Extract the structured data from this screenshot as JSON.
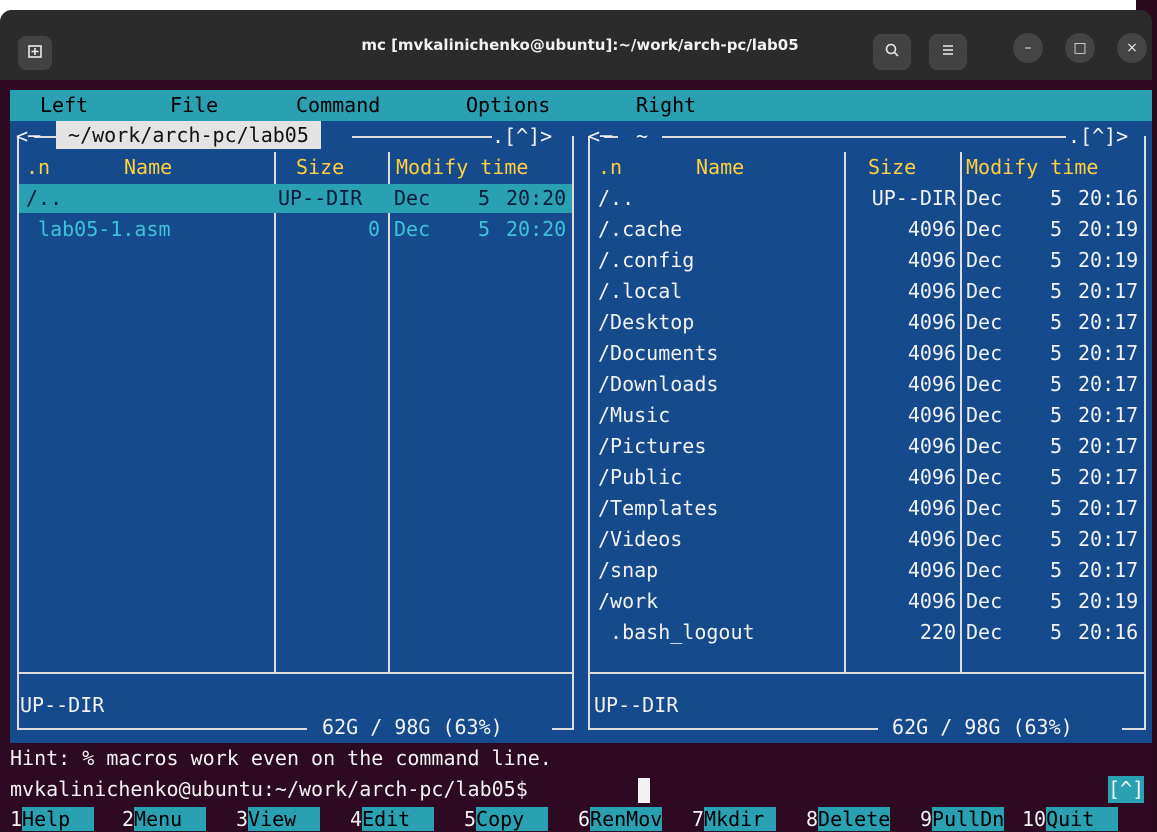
{
  "window": {
    "title": "mc [mvkalinichenko@ubuntu]:~/work/arch-pc/lab05",
    "new_tab_icon": "new-tab-icon",
    "buttons": {
      "search": "⌕",
      "menu": "≡",
      "minimize": "–",
      "maximize": "□",
      "close": "×"
    }
  },
  "menubar": {
    "items": [
      "Left",
      "File",
      "Command",
      "Options",
      "Right"
    ]
  },
  "left_panel": {
    "top_left": "<─",
    "path": " ~/work/arch-pc/lab05 ",
    "top_right": ".[^]>",
    "columns": [
      ".n",
      "Name",
      "Size",
      "Modify time"
    ],
    "rows": [
      {
        "name": "/..",
        "size": "UP--DIR",
        "month": "Dec",
        "day": "5",
        "time": "20:20"
      },
      {
        "name": " lab05-1.asm",
        "size": "0",
        "month": "Dec",
        "day": "5",
        "time": "20:20"
      }
    ],
    "status": "UP--DIR",
    "disk": " 62G / 98G (63%) "
  },
  "right_panel": {
    "top_left": "<─",
    "path": " ~ ",
    "top_right": ".[^]>",
    "columns": [
      ".n",
      "Name",
      "Size",
      "Modify time"
    ],
    "rows": [
      {
        "name": "/..",
        "size": "UP--DIR",
        "month": "Dec",
        "day": "5",
        "time": "20:16"
      },
      {
        "name": "/.cache",
        "size": "4096",
        "month": "Dec",
        "day": "5",
        "time": "20:19"
      },
      {
        "name": "/.config",
        "size": "4096",
        "month": "Dec",
        "day": "5",
        "time": "20:19"
      },
      {
        "name": "/.local",
        "size": "4096",
        "month": "Dec",
        "day": "5",
        "time": "20:17"
      },
      {
        "name": "/Desktop",
        "size": "4096",
        "month": "Dec",
        "day": "5",
        "time": "20:17"
      },
      {
        "name": "/Documents",
        "size": "4096",
        "month": "Dec",
        "day": "5",
        "time": "20:17"
      },
      {
        "name": "/Downloads",
        "size": "4096",
        "month": "Dec",
        "day": "5",
        "time": "20:17"
      },
      {
        "name": "/Music",
        "size": "4096",
        "month": "Dec",
        "day": "5",
        "time": "20:17"
      },
      {
        "name": "/Pictures",
        "size": "4096",
        "month": "Dec",
        "day": "5",
        "time": "20:17"
      },
      {
        "name": "/Public",
        "size": "4096",
        "month": "Dec",
        "day": "5",
        "time": "20:17"
      },
      {
        "name": "/Templates",
        "size": "4096",
        "month": "Dec",
        "day": "5",
        "time": "20:17"
      },
      {
        "name": "/Videos",
        "size": "4096",
        "month": "Dec",
        "day": "5",
        "time": "20:17"
      },
      {
        "name": "/snap",
        "size": "4096",
        "month": "Dec",
        "day": "5",
        "time": "20:17"
      },
      {
        "name": "/work",
        "size": "4096",
        "month": "Dec",
        "day": "5",
        "time": "20:19"
      },
      {
        "name": " .bash_logout",
        "size": "220",
        "month": "Dec",
        "day": "5",
        "time": "20:16"
      }
    ],
    "status": "UP--DIR",
    "disk": " 62G / 98G (63%) "
  },
  "hint": "Hint: % macros work even on the command line.",
  "prompt": "mvkalinichenko@ubuntu:~/work/arch-pc/lab05$",
  "caret_indicator": "[^]",
  "function_keys": [
    {
      "num": "1",
      "label": "Help  "
    },
    {
      "num": "2",
      "label": "Menu  "
    },
    {
      "num": "3",
      "label": "View  "
    },
    {
      "num": "4",
      "label": "Edit  "
    },
    {
      "num": "5",
      "label": "Copy  "
    },
    {
      "num": "6",
      "label": "RenMov"
    },
    {
      "num": "7",
      "label": "Mkdir "
    },
    {
      "num": "8",
      "label": "Delete"
    },
    {
      "num": "9",
      "label": "PullDn"
    },
    {
      "num": "10",
      "label": "Quit  "
    }
  ],
  "colors": {
    "panel_bg": "#154a8c",
    "menubar_bg": "#2aa1b3",
    "header_text": "#ffcf3f",
    "terminal_bg": "#2d0922"
  }
}
